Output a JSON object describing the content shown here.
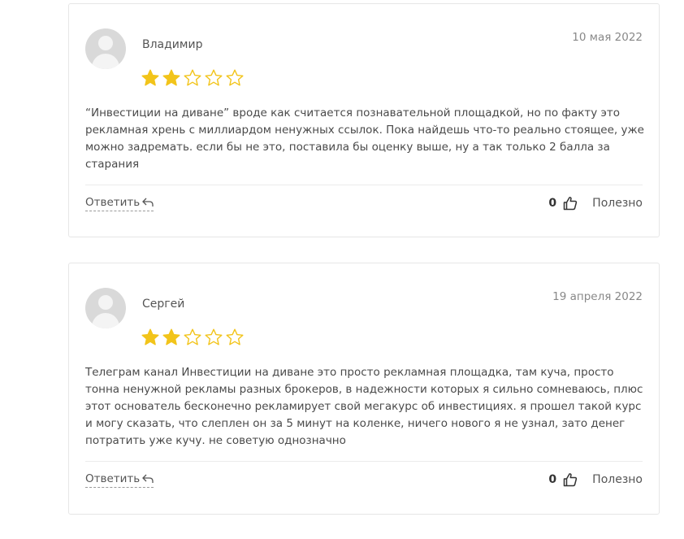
{
  "reviews": [
    {
      "author": "Владимир",
      "date": "10 мая 2022",
      "rating": 2,
      "max_rating": 5,
      "text": "“Инвестиции на диване” вроде как считается познавательной площадкой, но по факту это рекламная хрень с миллиардом ненужных ссылок. Пока найдешь что-то реально стоящее, уже можно задремать. если бы не это, поставила бы оценку выше, ну а так только 2 балла за старания",
      "reply_label": "Ответить",
      "likes": "0",
      "useful_label": "Полезно"
    },
    {
      "author": "Сергей",
      "date": "19 апреля 2022",
      "rating": 2,
      "max_rating": 5,
      "text": "Телеграм канал Инвестиции на диване это просто рекламная площадка, там куча, просто тонна ненужной рекламы разных брокеров, в надежности которых я сильно сомневаюсь, плюс этот основатель бесконечно рекламирует свой мегакурс об инвестициях. я прошел такой курс и могу сказать, что слеплен он за 5 минут на коленке, ничего нового я не узнал, зато денег потратить уже кучу. не советую однозначно",
      "reply_label": "Ответить",
      "likes": "0",
      "useful_label": "Полезно"
    }
  ],
  "colors": {
    "star_filled": "#f2c41a",
    "star_empty_stroke": "#f2c41a"
  }
}
